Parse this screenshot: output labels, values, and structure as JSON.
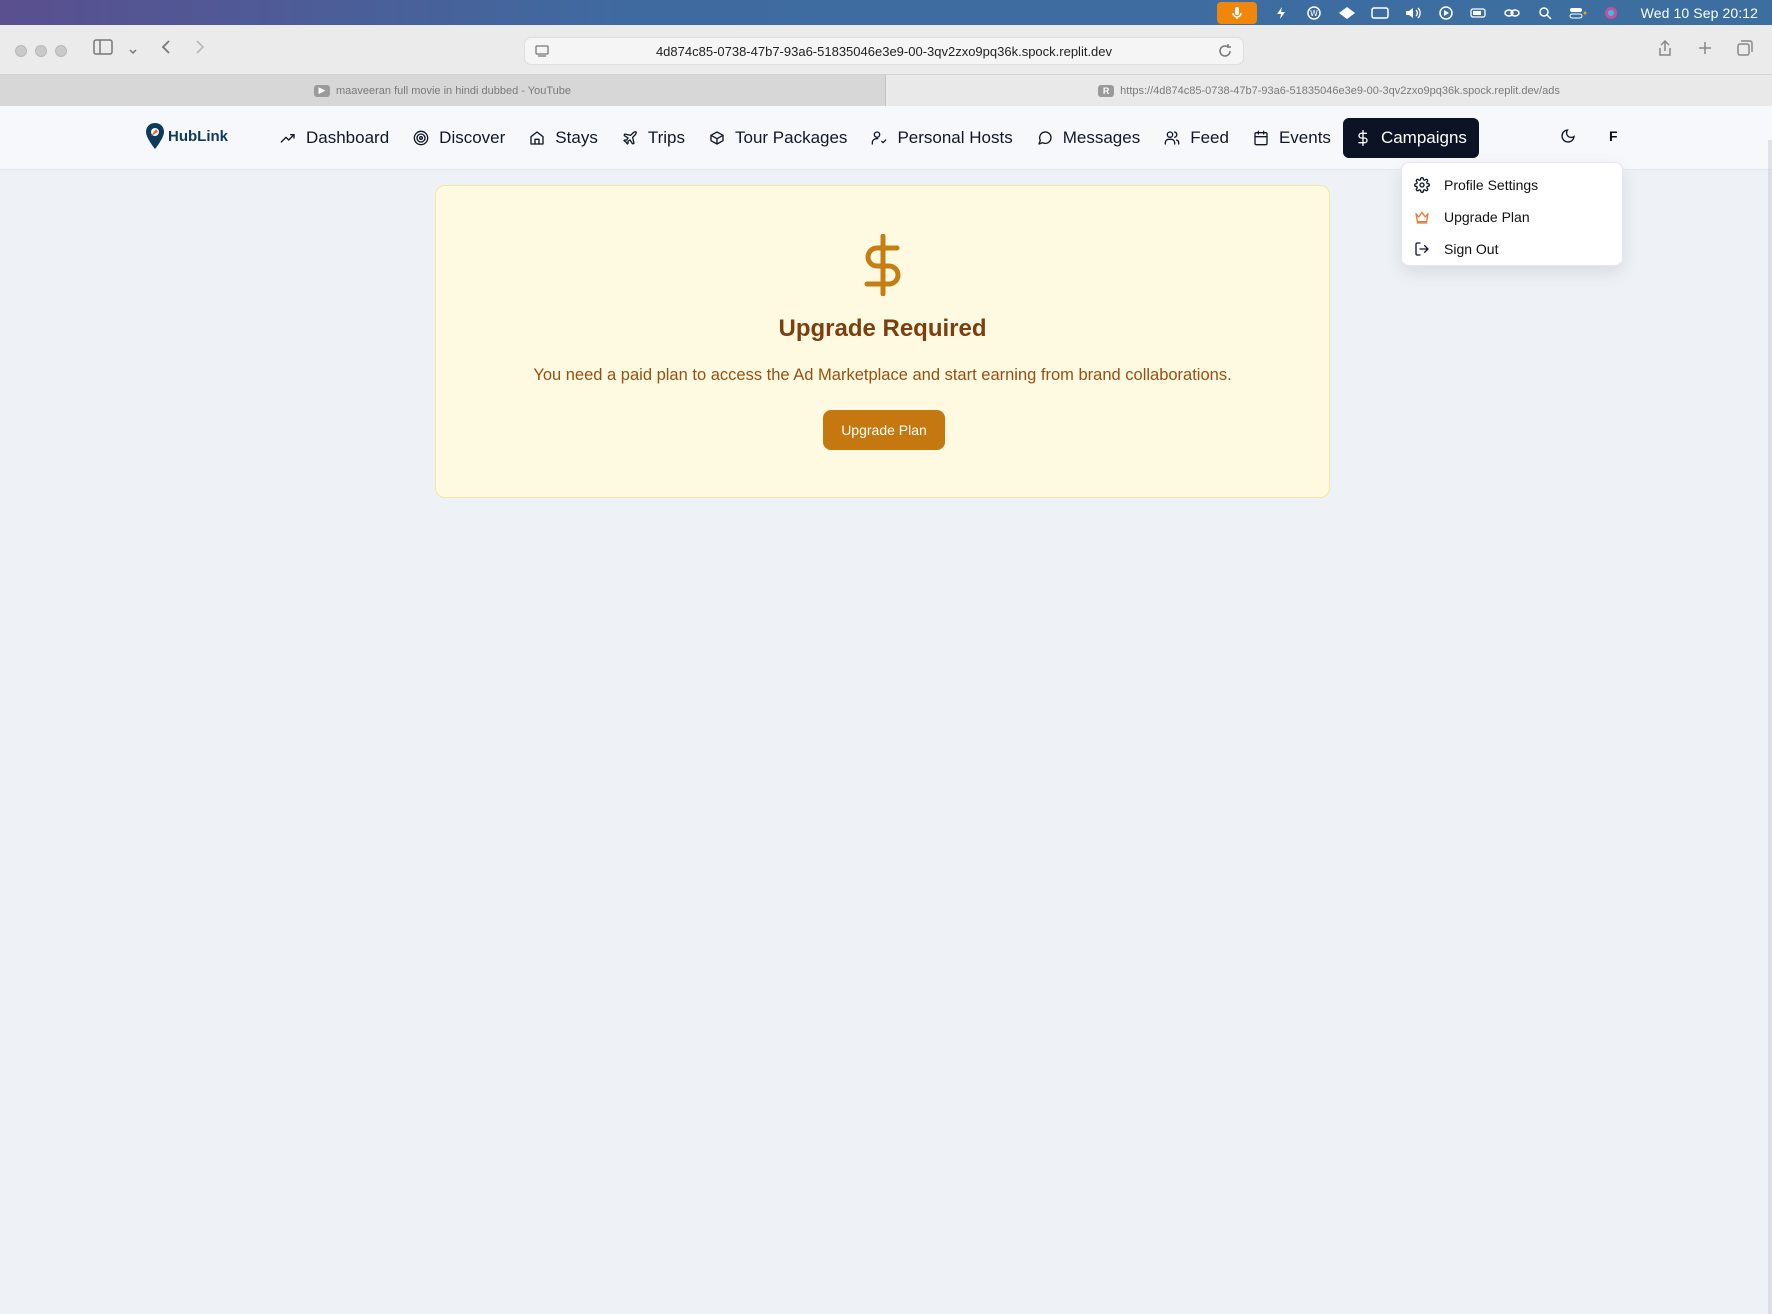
{
  "menubar": {
    "clock": "Wed 10 Sep  20:12"
  },
  "browser": {
    "url": "4d874c85-0738-47b7-93a6-51835046e3e9-00-3qv2zxo9pq36k.spock.replit.dev",
    "tabs": [
      {
        "label": "maaveeran full movie in hindi dubbed - YouTube",
        "favicon": "youtube-icon"
      },
      {
        "label": "https://4d874c85-0738-47b7-93a6-51835046e3e9-00-3qv2zxo9pq36k.spock.replit.dev/ads",
        "favicon": "R"
      }
    ]
  },
  "app": {
    "logo": "HubLink",
    "nav": [
      {
        "label": "Dashboard",
        "icon": "trending-up-icon"
      },
      {
        "label": "Discover",
        "icon": "target-icon"
      },
      {
        "label": "Stays",
        "icon": "home-icon"
      },
      {
        "label": "Trips",
        "icon": "plane-icon"
      },
      {
        "label": "Tour Packages",
        "icon": "package-icon"
      },
      {
        "label": "Personal Hosts",
        "icon": "user-check-icon"
      },
      {
        "label": "Messages",
        "icon": "message-circle-icon"
      },
      {
        "label": "Feed",
        "icon": "users-icon"
      },
      {
        "label": "Events",
        "icon": "calendar-icon"
      },
      {
        "label": "Campaigns",
        "icon": "dollar-icon",
        "active": true
      }
    ],
    "avatar_initial": "F",
    "dropdown": {
      "items": [
        {
          "label": "Profile Settings",
          "icon": "gear-icon"
        },
        {
          "label": "Upgrade Plan",
          "icon": "crown-icon"
        },
        {
          "label": "Sign Out",
          "icon": "logout-icon"
        }
      ]
    },
    "upgrade_card": {
      "title": "Upgrade Required",
      "message": "You need a paid plan to access the Ad Marketplace and start earning from brand collaborations.",
      "button": "Upgrade Plan"
    }
  },
  "colors": {
    "active_nav_bg": "#0b1324",
    "card_bg": "#fefae1",
    "accent": "#c5780f",
    "title": "#7c3f10"
  }
}
